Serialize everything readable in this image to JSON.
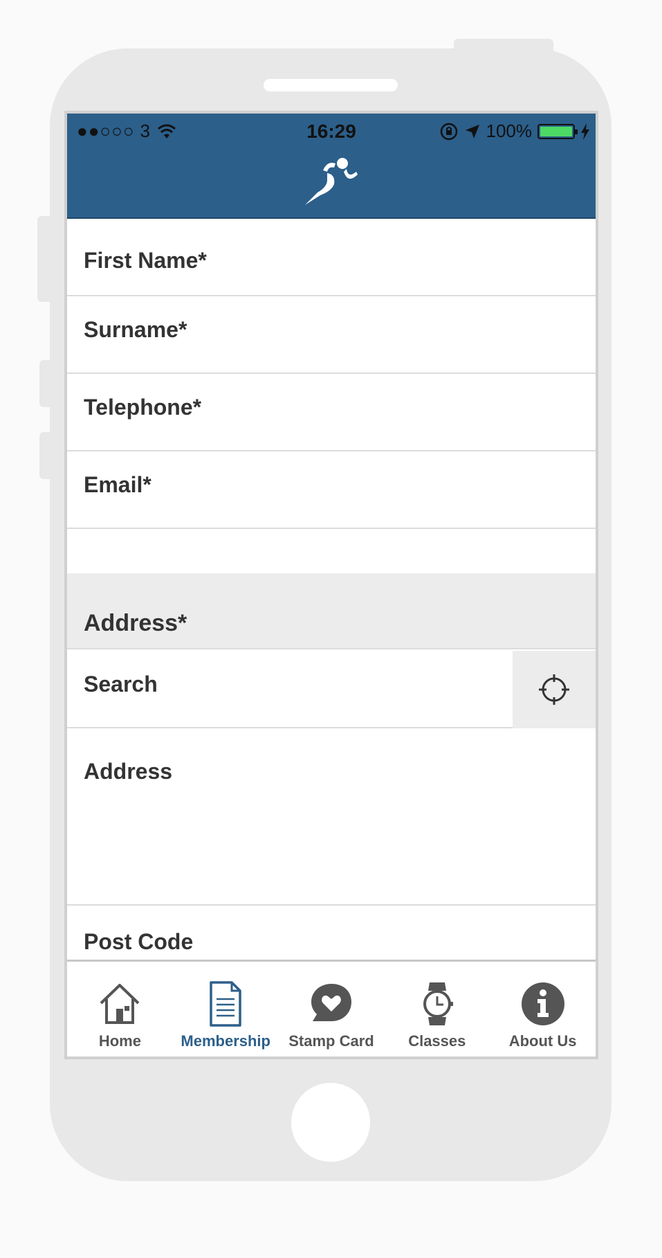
{
  "status_bar": {
    "carrier": "3",
    "signal": "●●○○○",
    "time": "16:29",
    "battery": "100%"
  },
  "form": {
    "fields": [
      {
        "label": "First Name*"
      },
      {
        "label": "Surname*"
      },
      {
        "label": "Telephone*"
      },
      {
        "label": "Email*"
      }
    ],
    "address_section": {
      "heading": "Address*",
      "search_label": "Search",
      "address_label": "Address",
      "postcode_label": "Post Code"
    }
  },
  "tabs": [
    {
      "label": "Home",
      "icon": "home-icon",
      "active": false
    },
    {
      "label": "Membership",
      "icon": "document-icon",
      "active": true
    },
    {
      "label": "Stamp Card",
      "icon": "heart-bubble-icon",
      "active": false
    },
    {
      "label": "Classes",
      "icon": "watch-icon",
      "active": false
    },
    {
      "label": "About Us",
      "icon": "info-icon",
      "active": false
    }
  ],
  "colors": {
    "nav_bar": "#2c5f8a",
    "active_tab": "#2c5f8a",
    "inactive_tab": "#555555",
    "battery": "#4cd964"
  }
}
